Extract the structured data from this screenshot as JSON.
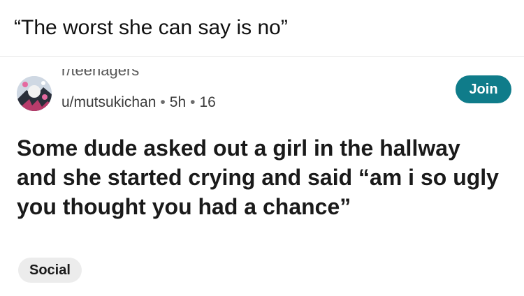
{
  "meme": {
    "caption": "“The worst she can say is no”"
  },
  "post": {
    "subreddit": "r/teenagers",
    "author": "u/mutsukichan",
    "separator": "•",
    "age": "5h",
    "score": "16",
    "join_label": "Join",
    "title": "Some dude asked out a girl in the hallway and she started crying and said “am i so ugly you thought you had a chance”",
    "flair": "Social",
    "colors": {
      "join_button_bg": "#0f7c8a",
      "flair_bg": "#ececec"
    },
    "icons": {
      "avatar": "user-avatar"
    }
  }
}
